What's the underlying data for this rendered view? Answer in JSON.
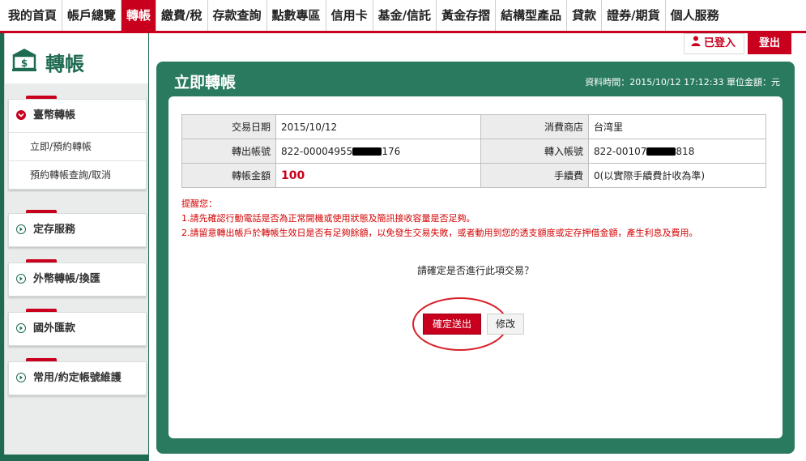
{
  "nav": {
    "items": [
      "我的首頁",
      "帳戶總覽",
      "轉帳",
      "繳費/稅",
      "存款查詢",
      "點數專區",
      "信用卡",
      "基金/信託",
      "黃金存摺",
      "結構型產品",
      "貸款",
      "證券/期貨",
      "個人服務"
    ],
    "active": "轉帳"
  },
  "account": {
    "login_label": "已登入",
    "logout_label": "登出"
  },
  "sidebar": {
    "title": "轉帳",
    "groups": [
      {
        "label": "臺幣轉帳",
        "expanded": true,
        "subitems": [
          "立即/預約轉帳",
          "預約轉帳查詢/取消"
        ]
      },
      {
        "label": "定存服務"
      },
      {
        "label": "外幣轉帳/換匯"
      },
      {
        "label": "國外匯款"
      },
      {
        "label": "常用/約定帳號維護"
      }
    ]
  },
  "panel": {
    "title": "立即轉帳",
    "info": "資料時間：2015/10/12 17:12:33 單位金額：元"
  },
  "details": {
    "date_label": "交易日期",
    "date_value": "2015/10/12",
    "merchant_label": "消費商店",
    "merchant_value": "台湾里",
    "from_label": "轉出帳號",
    "from_prefix": "822-00004955",
    "from_suffix": "176",
    "to_label": "轉入帳號",
    "to_prefix": "822-00107",
    "to_suffix": "818",
    "amount_label": "轉帳金額",
    "amount_value": "100",
    "fee_label": "手續費",
    "fee_value": "0(以實際手續費計收為準)"
  },
  "reminder": {
    "title": "提醒您：",
    "lines": [
      "1.請先確認行動電話是否為正常開機或使用狀態及簡訊接收容量是否足夠。",
      "2.請留意轉出帳戶於轉帳生效日是否有足夠餘額，以免發生交易失敗，或者動用到您的透支額度或定存押借金額，產生利息及費用。"
    ]
  },
  "confirm": {
    "question": "請確定是否進行此項交易？",
    "submit_label": "確定送出",
    "modify_label": "修改"
  },
  "colors": {
    "brand_red": "#c8001e",
    "panel_green": "#2a7a5f",
    "sidebar_green": "#1f6b52"
  }
}
